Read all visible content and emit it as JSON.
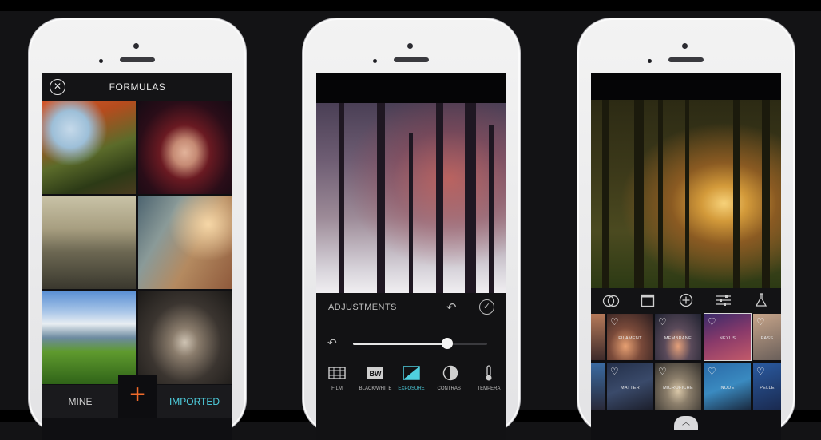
{
  "colors": {
    "accent_orange": "#f06a2a",
    "accent_cyan": "#4fd0e0",
    "screen_bg": "#0f0f12"
  },
  "phone1": {
    "title": "FORMULAS",
    "close_icon": "close-circle-icon",
    "tabs": {
      "mine": "MINE",
      "add": "+",
      "imported": "IMPORTED"
    }
  },
  "phone2": {
    "panel_title": "ADJUSTMENTS",
    "undo_icon": "undo-icon",
    "confirm_icon": "checkmark-circle-icon",
    "slider_value": 0.7,
    "tools": [
      {
        "label": "FILM",
        "icon": "film-icon"
      },
      {
        "label": "BLACK/WHITE",
        "icon": "bw-icon"
      },
      {
        "label": "EXPOSURE",
        "icon": "exposure-icon",
        "active": true
      },
      {
        "label": "CONTRAST",
        "icon": "contrast-icon"
      },
      {
        "label": "TEMPERA",
        "icon": "thermometer-icon"
      }
    ]
  },
  "phone3": {
    "toolbar_icons": [
      "blend-icon",
      "frame-icon",
      "add-icon",
      "sliders-icon",
      "flask-icon"
    ],
    "filters_row1": [
      "FILAMENT",
      "MEMBRANE",
      "NEXUS",
      "PASS"
    ],
    "filters_row2": [
      "MATTER",
      "MICROFICHE",
      "NODE",
      "PELLE"
    ],
    "selected_filter": "NEXUS"
  }
}
